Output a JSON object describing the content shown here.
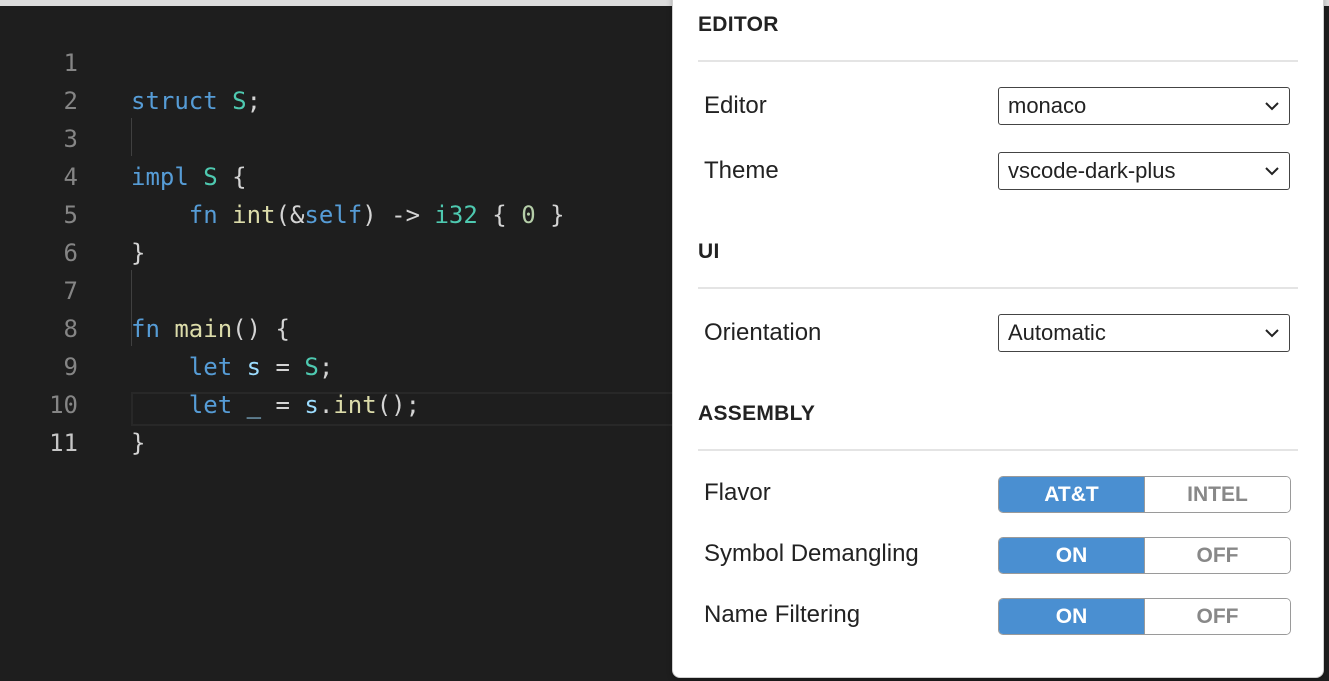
{
  "editor": {
    "lines": [
      {
        "num": "1"
      },
      {
        "num": "2"
      },
      {
        "num": "3"
      },
      {
        "num": "4"
      },
      {
        "num": "5"
      },
      {
        "num": "6"
      },
      {
        "num": "7"
      },
      {
        "num": "8"
      },
      {
        "num": "9"
      },
      {
        "num": "10"
      },
      {
        "num": "11"
      }
    ],
    "tokens": {
      "l1": [
        "struct",
        " ",
        "S",
        ";"
      ],
      "l3": [
        "impl",
        " ",
        "S",
        " {"
      ],
      "l4": [
        "    ",
        "fn",
        " ",
        "int",
        "(&",
        "self",
        ") -> ",
        "i32",
        " { ",
        "0",
        " }"
      ],
      "l5": [
        "}"
      ],
      "l7": [
        "fn",
        " ",
        "main",
        "() {"
      ],
      "l8": [
        "    ",
        "let",
        " ",
        "s",
        " = ",
        "S",
        ";"
      ],
      "l9": [
        "    ",
        "let",
        " ",
        "_",
        " = ",
        "s",
        ".",
        "int",
        "();"
      ],
      "l10": [
        "}"
      ]
    }
  },
  "config": {
    "editor_section": {
      "title": "EDITOR",
      "editor_label": "Editor",
      "editor_value": "monaco",
      "theme_label": "Theme",
      "theme_value": "vscode-dark-plus"
    },
    "ui_section": {
      "title": "UI",
      "orientation_label": "Orientation",
      "orientation_value": "Automatic"
    },
    "assembly_section": {
      "title": "ASSEMBLY",
      "flavor_label": "Flavor",
      "flavor_options": [
        "AT&T",
        "INTEL"
      ],
      "flavor_selected": "AT&T",
      "demangle_label": "Symbol Demangling",
      "demangle_options": [
        "ON",
        "OFF"
      ],
      "demangle_selected": "ON",
      "filter_label": "Name Filtering",
      "filter_options": [
        "ON",
        "OFF"
      ],
      "filter_selected": "ON"
    }
  },
  "colors": {
    "accent": "#4a8fd1",
    "editor_bg": "#1e1e1e",
    "keyword": "#569cd6",
    "type": "#4ec9b0",
    "function": "#dcdcaa",
    "variable": "#9cdcfe",
    "number": "#b5cea8"
  }
}
